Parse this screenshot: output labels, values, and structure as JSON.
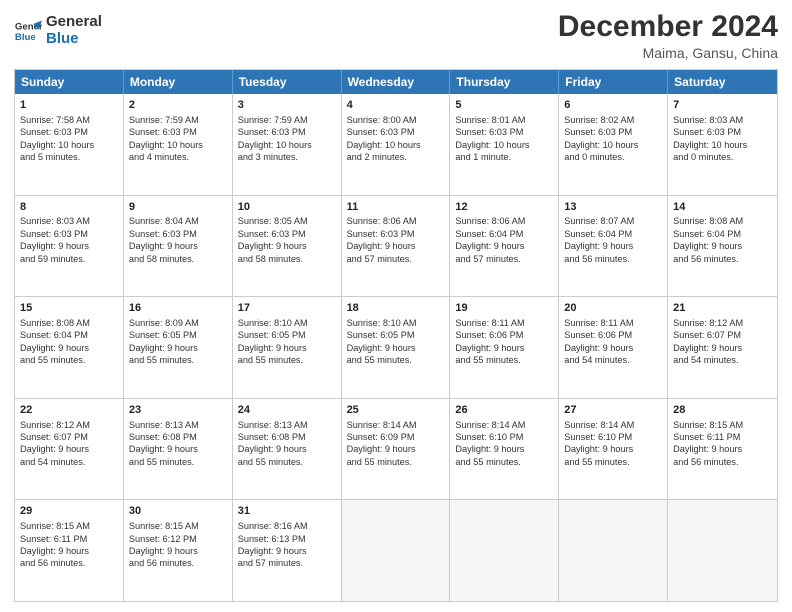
{
  "header": {
    "logo_line1": "General",
    "logo_line2": "Blue",
    "month_year": "December 2024",
    "location": "Maima, Gansu, China"
  },
  "weekdays": [
    "Sunday",
    "Monday",
    "Tuesday",
    "Wednesday",
    "Thursday",
    "Friday",
    "Saturday"
  ],
  "weeks": [
    [
      {
        "day": "1",
        "lines": [
          "Sunrise: 7:58 AM",
          "Sunset: 6:03 PM",
          "Daylight: 10 hours",
          "and 5 minutes."
        ]
      },
      {
        "day": "2",
        "lines": [
          "Sunrise: 7:59 AM",
          "Sunset: 6:03 PM",
          "Daylight: 10 hours",
          "and 4 minutes."
        ]
      },
      {
        "day": "3",
        "lines": [
          "Sunrise: 7:59 AM",
          "Sunset: 6:03 PM",
          "Daylight: 10 hours",
          "and 3 minutes."
        ]
      },
      {
        "day": "4",
        "lines": [
          "Sunrise: 8:00 AM",
          "Sunset: 6:03 PM",
          "Daylight: 10 hours",
          "and 2 minutes."
        ]
      },
      {
        "day": "5",
        "lines": [
          "Sunrise: 8:01 AM",
          "Sunset: 6:03 PM",
          "Daylight: 10 hours",
          "and 1 minute."
        ]
      },
      {
        "day": "6",
        "lines": [
          "Sunrise: 8:02 AM",
          "Sunset: 6:03 PM",
          "Daylight: 10 hours",
          "and 0 minutes."
        ]
      },
      {
        "day": "7",
        "lines": [
          "Sunrise: 8:03 AM",
          "Sunset: 6:03 PM",
          "Daylight: 10 hours",
          "and 0 minutes."
        ]
      }
    ],
    [
      {
        "day": "8",
        "lines": [
          "Sunrise: 8:03 AM",
          "Sunset: 6:03 PM",
          "Daylight: 9 hours",
          "and 59 minutes."
        ]
      },
      {
        "day": "9",
        "lines": [
          "Sunrise: 8:04 AM",
          "Sunset: 6:03 PM",
          "Daylight: 9 hours",
          "and 58 minutes."
        ]
      },
      {
        "day": "10",
        "lines": [
          "Sunrise: 8:05 AM",
          "Sunset: 6:03 PM",
          "Daylight: 9 hours",
          "and 58 minutes."
        ]
      },
      {
        "day": "11",
        "lines": [
          "Sunrise: 8:06 AM",
          "Sunset: 6:03 PM",
          "Daylight: 9 hours",
          "and 57 minutes."
        ]
      },
      {
        "day": "12",
        "lines": [
          "Sunrise: 8:06 AM",
          "Sunset: 6:04 PM",
          "Daylight: 9 hours",
          "and 57 minutes."
        ]
      },
      {
        "day": "13",
        "lines": [
          "Sunrise: 8:07 AM",
          "Sunset: 6:04 PM",
          "Daylight: 9 hours",
          "and 56 minutes."
        ]
      },
      {
        "day": "14",
        "lines": [
          "Sunrise: 8:08 AM",
          "Sunset: 6:04 PM",
          "Daylight: 9 hours",
          "and 56 minutes."
        ]
      }
    ],
    [
      {
        "day": "15",
        "lines": [
          "Sunrise: 8:08 AM",
          "Sunset: 6:04 PM",
          "Daylight: 9 hours",
          "and 55 minutes."
        ]
      },
      {
        "day": "16",
        "lines": [
          "Sunrise: 8:09 AM",
          "Sunset: 6:05 PM",
          "Daylight: 9 hours",
          "and 55 minutes."
        ]
      },
      {
        "day": "17",
        "lines": [
          "Sunrise: 8:10 AM",
          "Sunset: 6:05 PM",
          "Daylight: 9 hours",
          "and 55 minutes."
        ]
      },
      {
        "day": "18",
        "lines": [
          "Sunrise: 8:10 AM",
          "Sunset: 6:05 PM",
          "Daylight: 9 hours",
          "and 55 minutes."
        ]
      },
      {
        "day": "19",
        "lines": [
          "Sunrise: 8:11 AM",
          "Sunset: 6:06 PM",
          "Daylight: 9 hours",
          "and 55 minutes."
        ]
      },
      {
        "day": "20",
        "lines": [
          "Sunrise: 8:11 AM",
          "Sunset: 6:06 PM",
          "Daylight: 9 hours",
          "and 54 minutes."
        ]
      },
      {
        "day": "21",
        "lines": [
          "Sunrise: 8:12 AM",
          "Sunset: 6:07 PM",
          "Daylight: 9 hours",
          "and 54 minutes."
        ]
      }
    ],
    [
      {
        "day": "22",
        "lines": [
          "Sunrise: 8:12 AM",
          "Sunset: 6:07 PM",
          "Daylight: 9 hours",
          "and 54 minutes."
        ]
      },
      {
        "day": "23",
        "lines": [
          "Sunrise: 8:13 AM",
          "Sunset: 6:08 PM",
          "Daylight: 9 hours",
          "and 55 minutes."
        ]
      },
      {
        "day": "24",
        "lines": [
          "Sunrise: 8:13 AM",
          "Sunset: 6:08 PM",
          "Daylight: 9 hours",
          "and 55 minutes."
        ]
      },
      {
        "day": "25",
        "lines": [
          "Sunrise: 8:14 AM",
          "Sunset: 6:09 PM",
          "Daylight: 9 hours",
          "and 55 minutes."
        ]
      },
      {
        "day": "26",
        "lines": [
          "Sunrise: 8:14 AM",
          "Sunset: 6:10 PM",
          "Daylight: 9 hours",
          "and 55 minutes."
        ]
      },
      {
        "day": "27",
        "lines": [
          "Sunrise: 8:14 AM",
          "Sunset: 6:10 PM",
          "Daylight: 9 hours",
          "and 55 minutes."
        ]
      },
      {
        "day": "28",
        "lines": [
          "Sunrise: 8:15 AM",
          "Sunset: 6:11 PM",
          "Daylight: 9 hours",
          "and 56 minutes."
        ]
      }
    ],
    [
      {
        "day": "29",
        "lines": [
          "Sunrise: 8:15 AM",
          "Sunset: 6:11 PM",
          "Daylight: 9 hours",
          "and 56 minutes."
        ]
      },
      {
        "day": "30",
        "lines": [
          "Sunrise: 8:15 AM",
          "Sunset: 6:12 PM",
          "Daylight: 9 hours",
          "and 56 minutes."
        ]
      },
      {
        "day": "31",
        "lines": [
          "Sunrise: 8:16 AM",
          "Sunset: 6:13 PM",
          "Daylight: 9 hours",
          "and 57 minutes."
        ]
      },
      {
        "day": "",
        "lines": []
      },
      {
        "day": "",
        "lines": []
      },
      {
        "day": "",
        "lines": []
      },
      {
        "day": "",
        "lines": []
      }
    ]
  ]
}
